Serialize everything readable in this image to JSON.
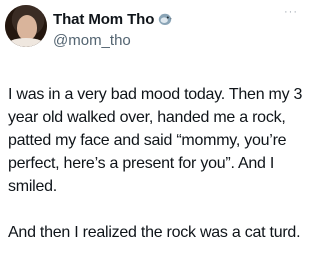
{
  "tweet": {
    "author": {
      "display_name": "That Mom Tho",
      "handle": "@mom_tho",
      "badge_icon": "bird-badge-icon"
    },
    "more_menu": "···",
    "paragraphs": [
      "I was in a very bad mood today. Then my 3 year old walked over, handed me a rock, patted my face and said “mommy, you’re perfect, here’s a present for you”. And I smiled.",
      "And then I realized the rock was a cat turd."
    ]
  },
  "colors": {
    "text": "#0f1419",
    "handle": "#536471",
    "badge": "#6d8fa8"
  }
}
